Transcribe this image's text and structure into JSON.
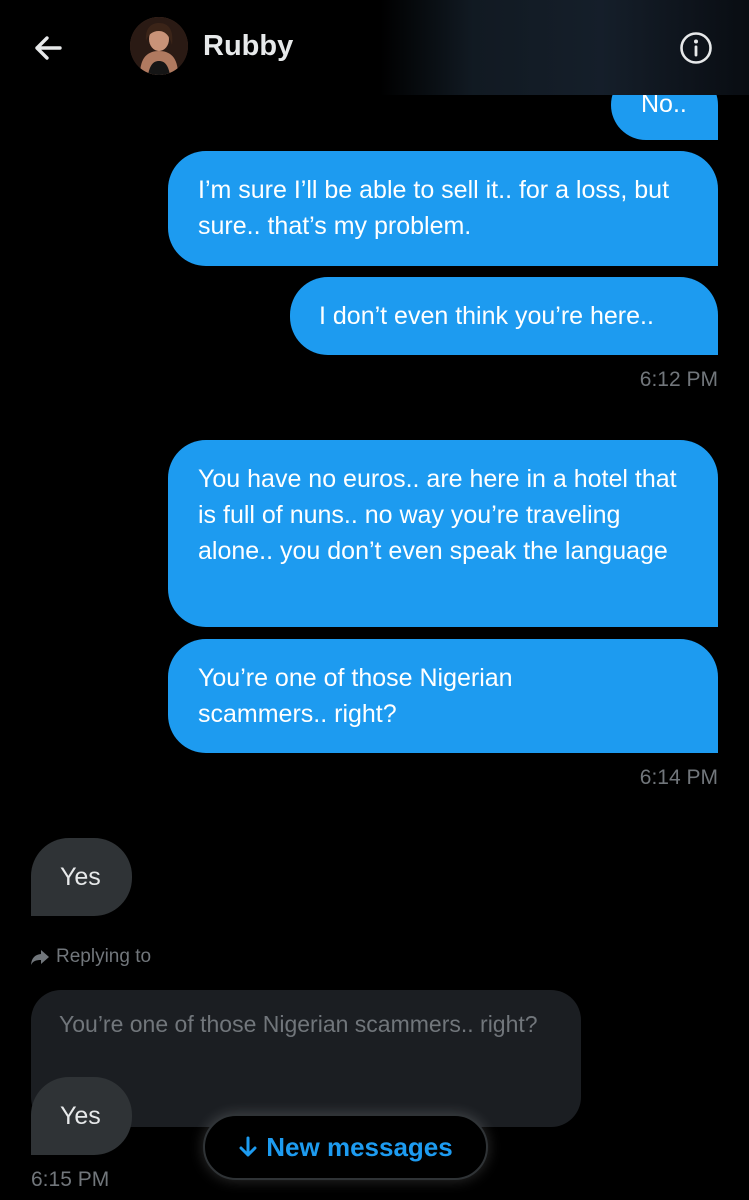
{
  "header": {
    "contact_name": "Rubby",
    "back_icon": "arrow-left-icon",
    "info_icon": "info-circle-icon"
  },
  "messages": [
    {
      "text": "No..",
      "direction": "sent"
    },
    {
      "text": "I’m sure I’ll be able to sell it.. for a loss, but sure.. that’s my problem.",
      "direction": "sent"
    },
    {
      "text": "I don’t even think you’re here..",
      "direction": "sent"
    },
    {
      "text": "You have no euros.. are here in a hotel that is full of nuns.. no way you’re traveling alone.. you don’t even speak the language",
      "direction": "sent"
    },
    {
      "text": "You’re one of those Nigerian scammers.. right?",
      "direction": "sent"
    },
    {
      "text": "Yes",
      "direction": "received"
    },
    {
      "text": "Yes",
      "direction": "received"
    }
  ],
  "timestamps": {
    "t1": "6:12 PM",
    "t2": "6:14 PM",
    "t3": "6:15 PM"
  },
  "reply": {
    "label": "Replying to",
    "quoted_text": "You’re one of those Nigerian scammers.. right?"
  },
  "new_messages_button": "New messages",
  "colors": {
    "accent": "#1d9bf0",
    "received_bubble": "#2f3336",
    "background": "#000000",
    "muted_text": "#71767b"
  }
}
